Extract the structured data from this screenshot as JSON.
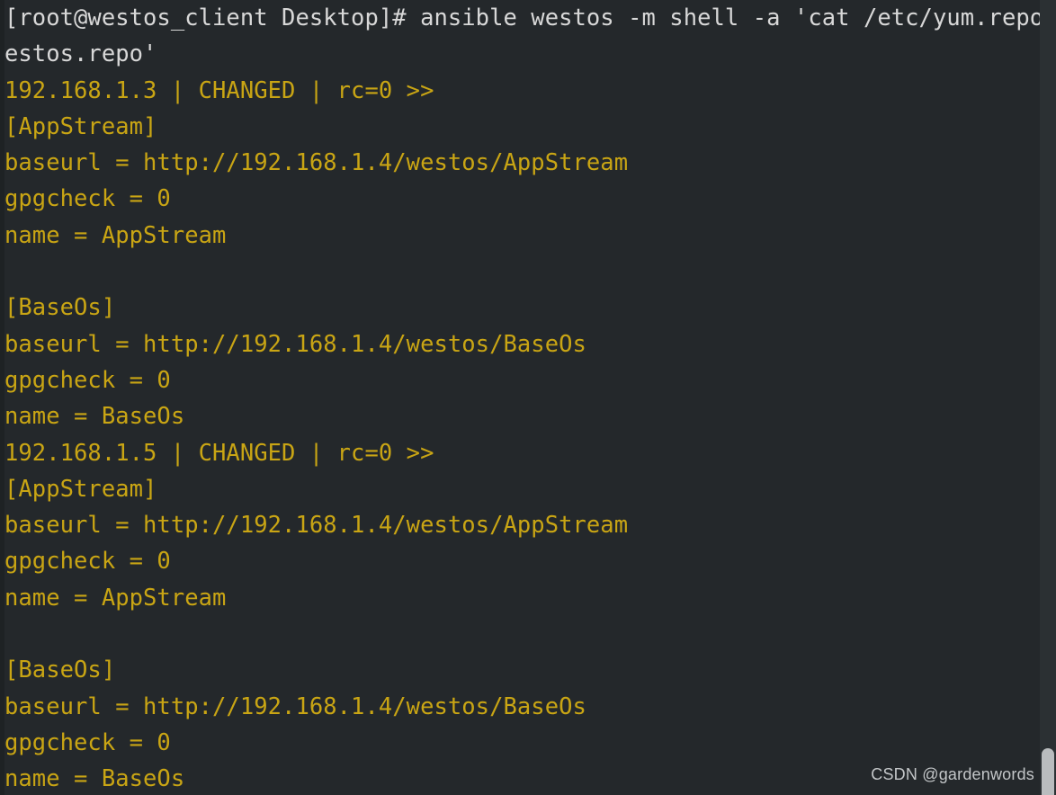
{
  "terminal": {
    "background_color": "#24282b",
    "prompt_color": "#d8d8d8",
    "output_color": "#c9a514",
    "prompt_line": "[root@westos_client Desktop]# ansible westos -m shell -a 'cat /etc/yum.repos.d/w",
    "prompt_line_wrapped": "estos.repo'",
    "lines": [
      {
        "text": "192.168.1.3 | CHANGED | rc=0 >>",
        "color": "gold"
      },
      {
        "text": "[AppStream]",
        "color": "gold"
      },
      {
        "text": "baseurl = http://192.168.1.4/westos/AppStream",
        "color": "gold"
      },
      {
        "text": "gpgcheck = 0",
        "color": "gold"
      },
      {
        "text": "name = AppStream",
        "color": "gold"
      },
      {
        "text": "",
        "color": "gold"
      },
      {
        "text": "[BaseOs]",
        "color": "gold"
      },
      {
        "text": "baseurl = http://192.168.1.4/westos/BaseOs",
        "color": "gold"
      },
      {
        "text": "gpgcheck = 0",
        "color": "gold"
      },
      {
        "text": "name = BaseOs",
        "color": "gold"
      },
      {
        "text": "192.168.1.5 | CHANGED | rc=0 >>",
        "color": "gold"
      },
      {
        "text": "[AppStream]",
        "color": "gold"
      },
      {
        "text": "baseurl = http://192.168.1.4/westos/AppStream",
        "color": "gold"
      },
      {
        "text": "gpgcheck = 0",
        "color": "gold"
      },
      {
        "text": "name = AppStream",
        "color": "gold"
      },
      {
        "text": "",
        "color": "gold"
      },
      {
        "text": "[BaseOs]",
        "color": "gold"
      },
      {
        "text": "baseurl = http://192.168.1.4/westos/BaseOs",
        "color": "gold"
      },
      {
        "text": "gpgcheck = 0",
        "color": "gold"
      },
      {
        "text": "name = BaseOs",
        "color": "gold"
      }
    ]
  },
  "watermark": {
    "text": "CSDN @gardenwords"
  },
  "scrollbar": {
    "position": "right",
    "thumb_position": "bottom"
  }
}
